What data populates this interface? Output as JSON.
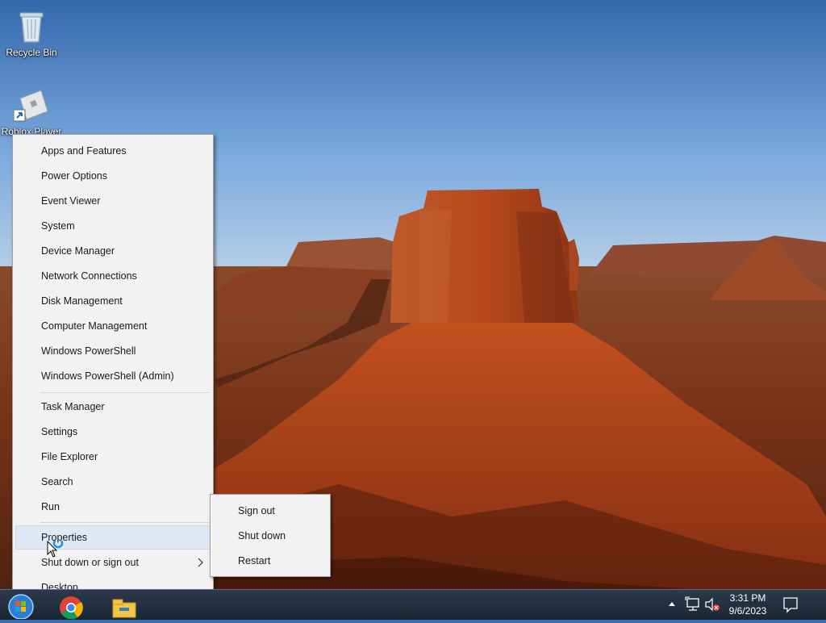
{
  "desktop": {
    "icons": [
      {
        "label": "Recycle Bin",
        "icon": "recycle-bin-icon"
      },
      {
        "label": "Roblox Player",
        "icon": "roblox-icon"
      }
    ]
  },
  "context_menu": {
    "group1": [
      "Apps and Features",
      "Power Options",
      "Event Viewer",
      "System",
      "Device Manager",
      "Network Connections",
      "Disk Management",
      "Computer Management",
      "Windows PowerShell",
      "Windows PowerShell (Admin)"
    ],
    "group2": [
      "Task Manager",
      "Settings",
      "File Explorer",
      "Search",
      "Run"
    ],
    "group3": [
      "Properties",
      "Shut down or sign out",
      "Desktop"
    ],
    "hovered": "Properties"
  },
  "shutdown_submenu": {
    "items": [
      "Sign out",
      "Shut down",
      "Restart"
    ]
  },
  "taskbar": {
    "pinned": [
      "start-orb-icon",
      "chrome-icon",
      "file-explorer-icon"
    ],
    "tray": {
      "icons": [
        "show-hidden-icons-chevron",
        "network-icon",
        "volume-muted-icon",
        "action-center-icon"
      ],
      "time": "3:31 PM",
      "date": "9/6/2023"
    }
  },
  "colors": {
    "taskbar": "#1f2b38",
    "menu_bg": "#f2f2f2",
    "hover_bg": "#dfe9f6",
    "sky_top": "#3a6db0",
    "rock": "#b5461d"
  }
}
